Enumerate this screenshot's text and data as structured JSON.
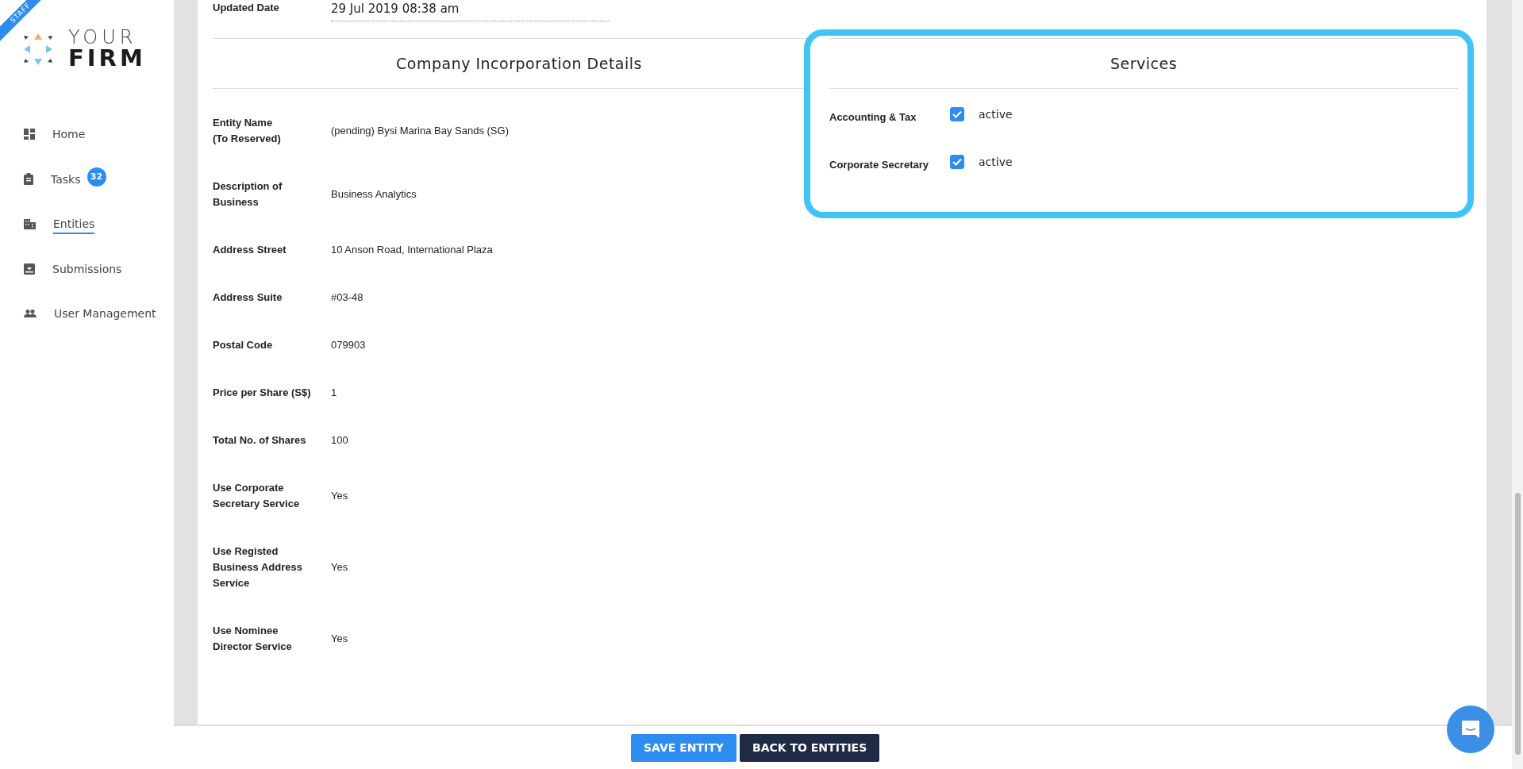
{
  "sidebar": {
    "ribbon": "STAFF",
    "logo": {
      "line_1": "YOUR",
      "line_2": "FIRM"
    },
    "items": [
      {
        "label": "Home",
        "selected": false
      },
      {
        "label": "Tasks",
        "badge": "32",
        "selected": false
      },
      {
        "label": "Entities",
        "selected": true
      },
      {
        "label": "Submissions",
        "selected": false
      },
      {
        "label": "User Management",
        "selected": false
      }
    ]
  },
  "updated": {
    "label": "Updated Date",
    "value": "29 Jul 2019 08:38 am"
  },
  "incorporation": {
    "title": "Company Incorporation Details",
    "rows": [
      {
        "label": "Entity Name\n(To Reserved)",
        "value": "(pending) Bysi Marina Bay Sands (SG)"
      },
      {
        "label": "Description of\nBusiness",
        "value": "Business Analytics"
      },
      {
        "label": "Address Street",
        "value": "10 Anson Road, International Plaza"
      },
      {
        "label": "Address Suite",
        "value": "#03-48"
      },
      {
        "label": "Postal Code",
        "value": "079903"
      },
      {
        "label": "Price per Share (S$)",
        "value": "1"
      },
      {
        "label": "Total No. of Shares",
        "value": "100"
      },
      {
        "label": "Use Corporate\nSecretary Service",
        "value": "Yes"
      },
      {
        "label": "Use Registed\nBusiness Address\nService",
        "value": "Yes"
      },
      {
        "label": "Use Nominee\nDirector Service",
        "value": "Yes"
      }
    ]
  },
  "services": {
    "title": "Services",
    "items": [
      {
        "label": "Accounting & Tax",
        "checked": true,
        "status": "active"
      },
      {
        "label": "Corporate Secretary",
        "checked": true,
        "status": "active"
      }
    ]
  },
  "buttons": [
    {
      "label": "SAVE ENTITY",
      "kind": "primary"
    },
    {
      "label": "BACK TO ENTITIES",
      "kind": "secondary"
    }
  ]
}
